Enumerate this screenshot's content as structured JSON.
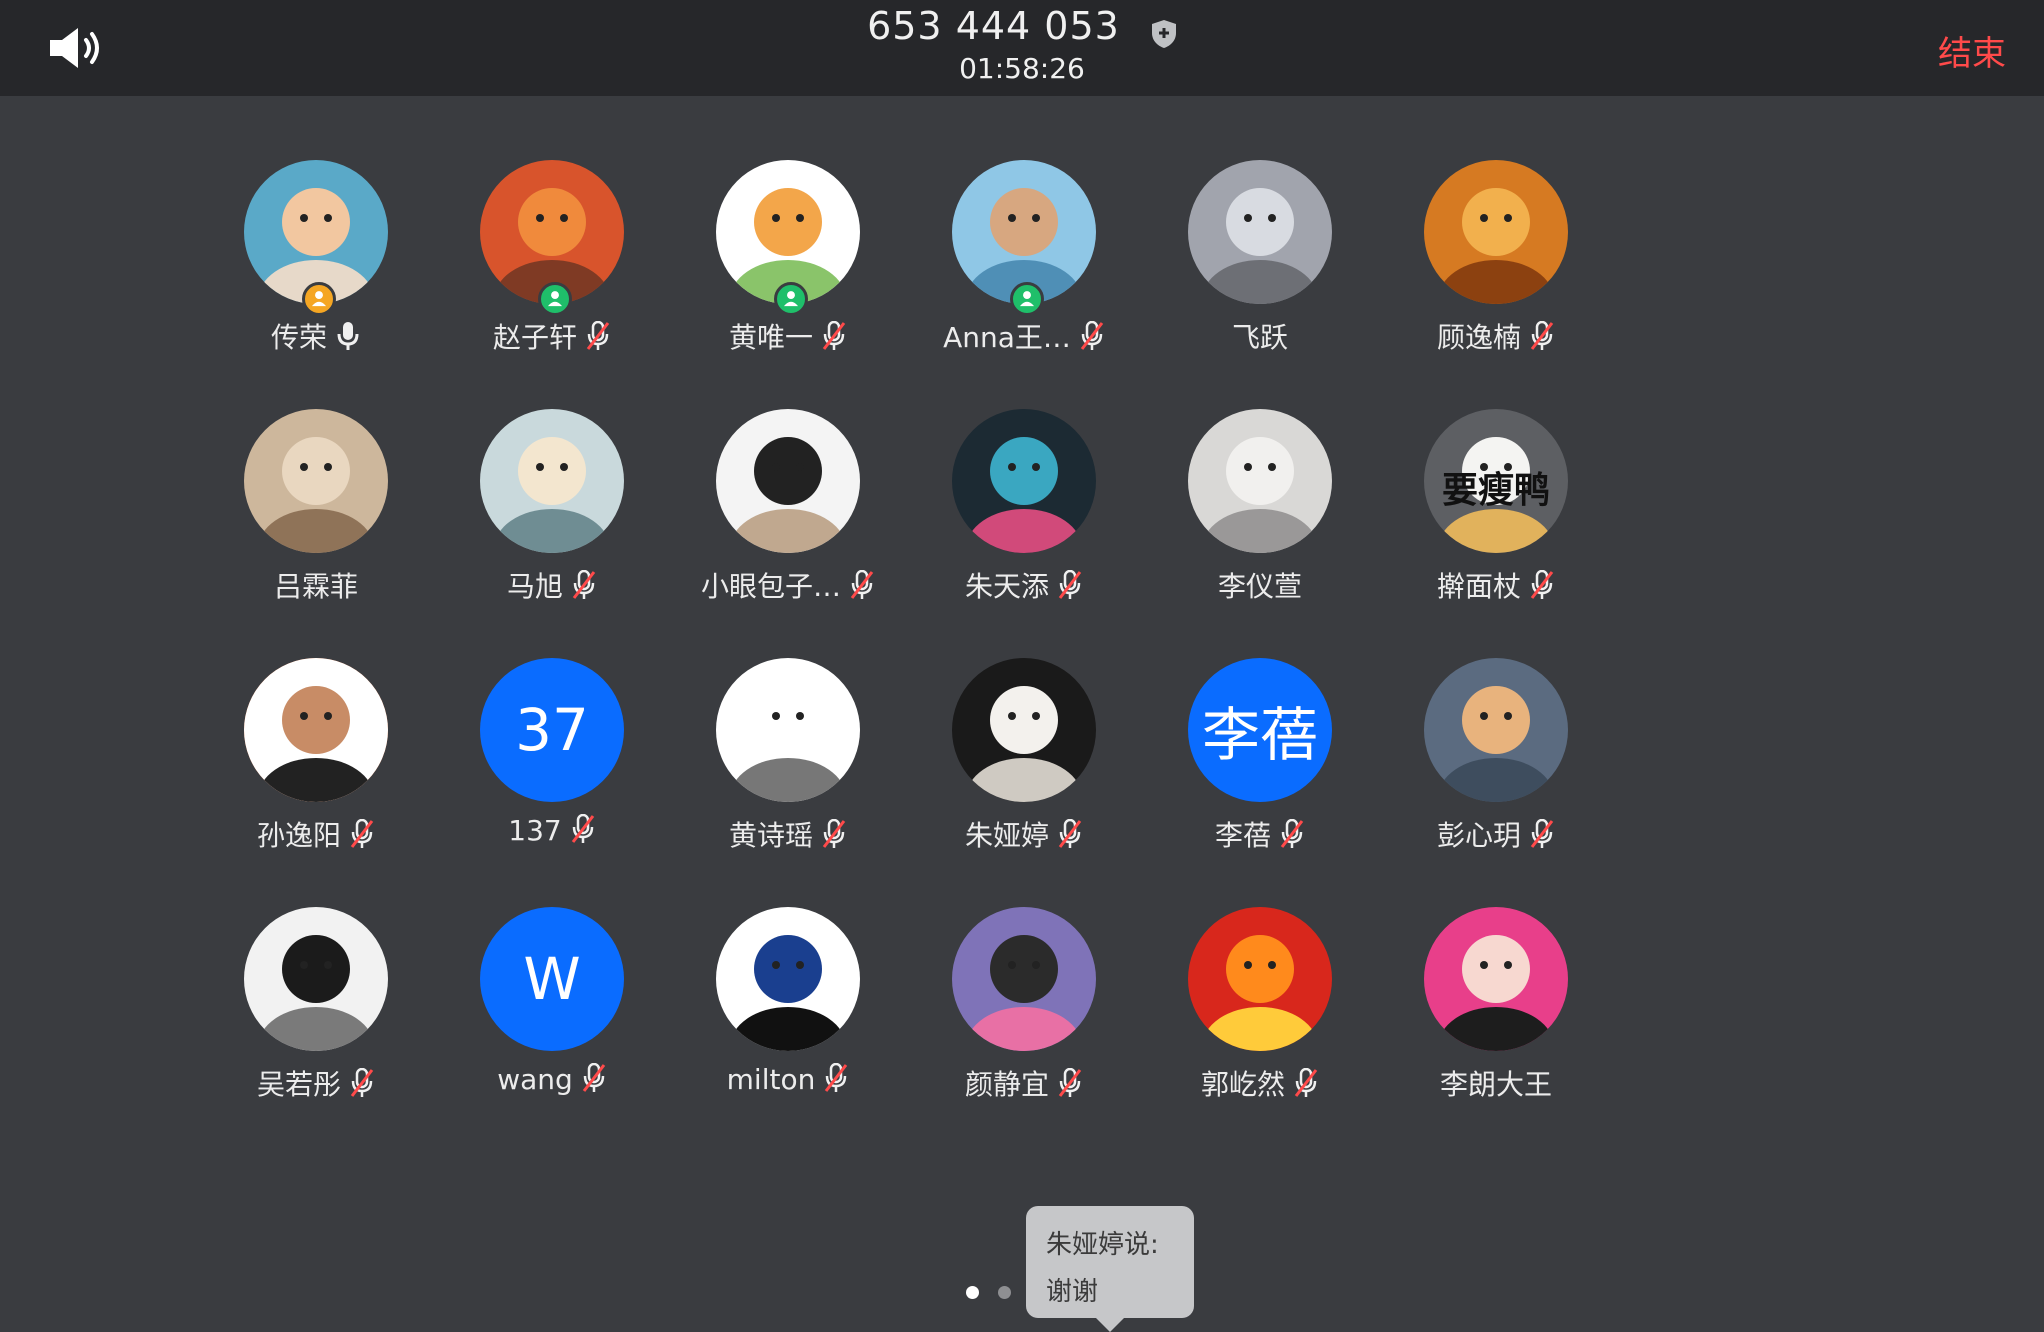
{
  "header": {
    "meeting_id": "653 444 053",
    "timer": "01:58:26",
    "end_label": "结束",
    "speaker_icon": "speaker-icon",
    "shield_icon": "shield-icon"
  },
  "colors": {
    "topbar": "#26272a",
    "background": "#3a3c40",
    "end": "#ff4a4a",
    "text_avatar": "#0a6cff",
    "host_badge": "#f5a623",
    "cohost_badge": "#1fbf6a",
    "ring": "#ff5b0a"
  },
  "participants": [
    {
      "name": "传荣",
      "mic": "on",
      "badge": "host"
    },
    {
      "name": "赵子轩",
      "mic": "muted",
      "badge": "cohost"
    },
    {
      "name": "黄唯一",
      "mic": "muted",
      "badge": "cohost"
    },
    {
      "name": "Anna王…",
      "mic": "muted",
      "badge": "cohost"
    },
    {
      "name": "飞跃",
      "mic": "none",
      "badge": ""
    },
    {
      "name": "顾逸楠",
      "mic": "muted",
      "badge": ""
    },
    {
      "name": "吕霖菲",
      "mic": "none",
      "badge": ""
    },
    {
      "name": "马旭",
      "mic": "muted",
      "badge": ""
    },
    {
      "name": "小眼包子…",
      "mic": "muted",
      "badge": ""
    },
    {
      "name": "朱天添",
      "mic": "muted",
      "badge": ""
    },
    {
      "name": "李仪萱",
      "mic": "none",
      "badge": ""
    },
    {
      "name": "擀面杖",
      "mic": "muted",
      "badge": "",
      "avatar_text": "要瘦鸭"
    },
    {
      "name": "孙逸阳",
      "mic": "muted",
      "badge": ""
    },
    {
      "name": "137",
      "mic": "muted",
      "badge": "",
      "avatar_text": "37"
    },
    {
      "name": "黄诗瑶",
      "mic": "muted",
      "badge": ""
    },
    {
      "name": "朱娅婷",
      "mic": "muted",
      "badge": ""
    },
    {
      "name": "李蓓",
      "mic": "muted",
      "badge": "",
      "avatar_text": "李蓓"
    },
    {
      "name": "彭心玥",
      "mic": "muted",
      "badge": ""
    },
    {
      "name": "吴若彤",
      "mic": "muted",
      "badge": ""
    },
    {
      "name": "wang",
      "mic": "muted",
      "badge": "",
      "avatar_text": "W"
    },
    {
      "name": "milton",
      "mic": "muted",
      "badge": ""
    },
    {
      "name": "颜静宜",
      "mic": "muted",
      "badge": ""
    },
    {
      "name": "郭屹然",
      "mic": "muted",
      "badge": ""
    },
    {
      "name": "李朗大王",
      "mic": "none",
      "badge": ""
    }
  ],
  "pager": {
    "pages": 3,
    "current": 1
  },
  "toast": {
    "line1": "朱娅婷说:",
    "line2": "谢谢"
  }
}
